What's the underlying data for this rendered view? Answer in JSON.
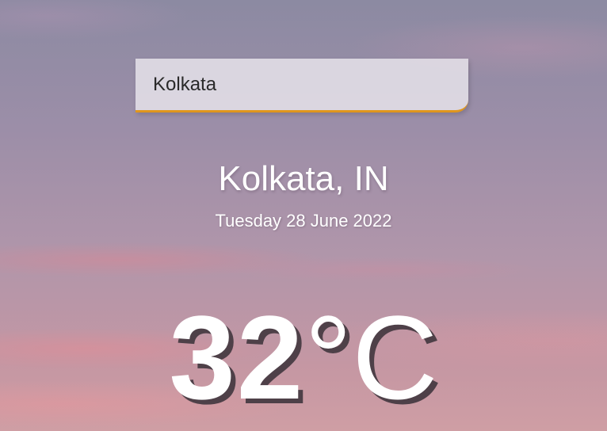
{
  "search": {
    "value": "Kolkata",
    "accent_color": "#e0961d"
  },
  "location": {
    "text": "Kolkata, IN"
  },
  "date": {
    "text": "Tuesday 28 June 2022"
  },
  "weather": {
    "temperature": "32",
    "unit": "°C"
  }
}
